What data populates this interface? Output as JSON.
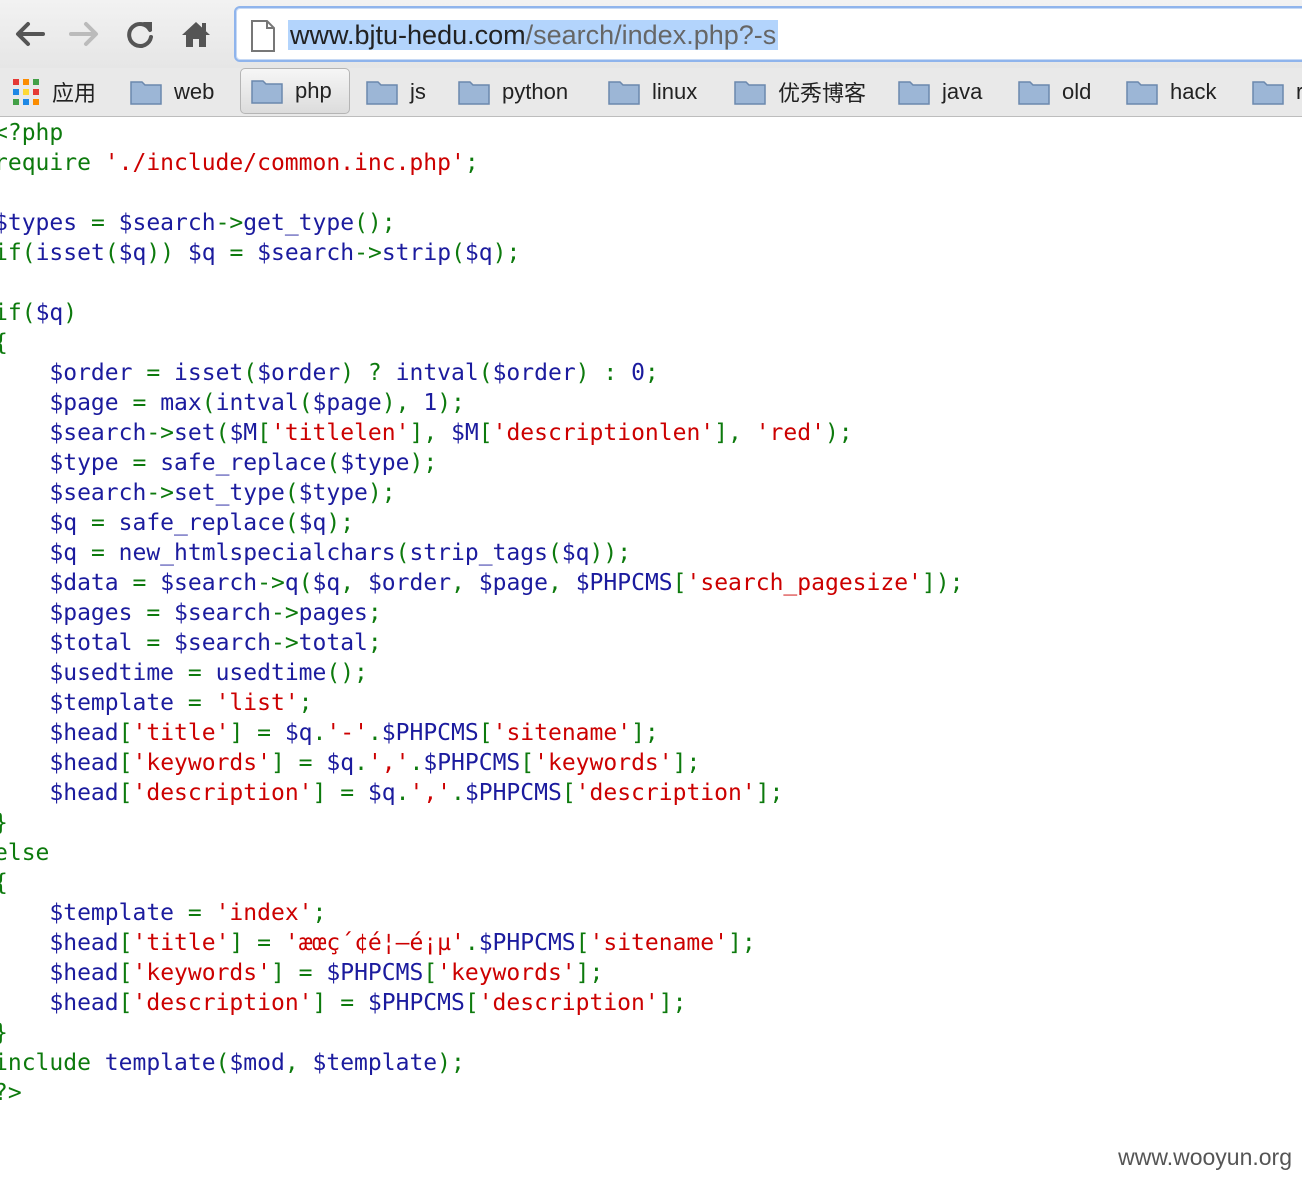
{
  "browser": {
    "url_host": "www.bjtu-hedu.com",
    "url_path": "/search/index.php?-s",
    "bookmarks": [
      {
        "label": "应用",
        "icon": "apps-grid-icon"
      },
      {
        "label": "web",
        "icon": "folder-icon"
      },
      {
        "label": "php",
        "icon": "folder-icon",
        "active": true
      },
      {
        "label": "js",
        "icon": "folder-icon"
      },
      {
        "label": "python",
        "icon": "folder-icon"
      },
      {
        "label": "linux",
        "icon": "folder-icon"
      },
      {
        "label": "优秀博客",
        "icon": "folder-icon"
      },
      {
        "label": "java",
        "icon": "folder-icon"
      },
      {
        "label": "old",
        "icon": "folder-icon"
      },
      {
        "label": "hack",
        "icon": "folder-icon"
      },
      {
        "label": "r",
        "icon": "folder-icon"
      }
    ]
  },
  "source": {
    "lines": [
      [
        [
          "kw",
          "<?php"
        ]
      ],
      [
        [
          "kw",
          "require "
        ],
        [
          "str",
          "'./include/common.inc.php'"
        ],
        [
          "op",
          ";"
        ]
      ],
      [],
      [
        [
          "var",
          "$types "
        ],
        [
          "op",
          "= "
        ],
        [
          "var",
          "$search"
        ],
        [
          "op",
          "->"
        ],
        [
          "fn",
          "get_type"
        ],
        [
          "op",
          "();"
        ]
      ],
      [
        [
          "kw",
          "if"
        ],
        [
          "op",
          "("
        ],
        [
          "fn",
          "isset"
        ],
        [
          "op",
          "("
        ],
        [
          "var",
          "$q"
        ],
        [
          "op",
          ")) "
        ],
        [
          "var",
          "$q "
        ],
        [
          "op",
          "= "
        ],
        [
          "var",
          "$search"
        ],
        [
          "op",
          "->"
        ],
        [
          "fn",
          "strip"
        ],
        [
          "op",
          "("
        ],
        [
          "var",
          "$q"
        ],
        [
          "op",
          ");"
        ]
      ],
      [],
      [
        [
          "kw",
          "if"
        ],
        [
          "op",
          "("
        ],
        [
          "var",
          "$q"
        ],
        [
          "op",
          ")"
        ]
      ],
      [
        [
          "op",
          "{"
        ]
      ],
      [
        [
          "op",
          "    "
        ],
        [
          "var",
          "$order "
        ],
        [
          "op",
          "= "
        ],
        [
          "fn",
          "isset"
        ],
        [
          "op",
          "("
        ],
        [
          "var",
          "$order"
        ],
        [
          "op",
          ") ? "
        ],
        [
          "fn",
          "intval"
        ],
        [
          "op",
          "("
        ],
        [
          "var",
          "$order"
        ],
        [
          "op",
          ") : "
        ],
        [
          "var",
          "0"
        ],
        [
          "op",
          ";"
        ]
      ],
      [
        [
          "op",
          "    "
        ],
        [
          "var",
          "$page "
        ],
        [
          "op",
          "= "
        ],
        [
          "fn",
          "max"
        ],
        [
          "op",
          "("
        ],
        [
          "fn",
          "intval"
        ],
        [
          "op",
          "("
        ],
        [
          "var",
          "$page"
        ],
        [
          "op",
          "), "
        ],
        [
          "var",
          "1"
        ],
        [
          "op",
          ");"
        ]
      ],
      [
        [
          "op",
          "    "
        ],
        [
          "var",
          "$search"
        ],
        [
          "op",
          "->"
        ],
        [
          "fn",
          "set"
        ],
        [
          "op",
          "("
        ],
        [
          "var",
          "$M"
        ],
        [
          "op",
          "["
        ],
        [
          "str",
          "'titlelen'"
        ],
        [
          "op",
          "], "
        ],
        [
          "var",
          "$M"
        ],
        [
          "op",
          "["
        ],
        [
          "str",
          "'descriptionlen'"
        ],
        [
          "op",
          "], "
        ],
        [
          "str",
          "'red'"
        ],
        [
          "op",
          ");"
        ]
      ],
      [
        [
          "op",
          "    "
        ],
        [
          "var",
          "$type "
        ],
        [
          "op",
          "= "
        ],
        [
          "fn",
          "safe_replace"
        ],
        [
          "op",
          "("
        ],
        [
          "var",
          "$type"
        ],
        [
          "op",
          ");"
        ]
      ],
      [
        [
          "op",
          "    "
        ],
        [
          "var",
          "$search"
        ],
        [
          "op",
          "->"
        ],
        [
          "fn",
          "set_type"
        ],
        [
          "op",
          "("
        ],
        [
          "var",
          "$type"
        ],
        [
          "op",
          ");"
        ]
      ],
      [
        [
          "op",
          "    "
        ],
        [
          "var",
          "$q "
        ],
        [
          "op",
          "= "
        ],
        [
          "fn",
          "safe_replace"
        ],
        [
          "op",
          "("
        ],
        [
          "var",
          "$q"
        ],
        [
          "op",
          ");"
        ]
      ],
      [
        [
          "op",
          "    "
        ],
        [
          "var",
          "$q "
        ],
        [
          "op",
          "= "
        ],
        [
          "fn",
          "new_htmlspecialchars"
        ],
        [
          "op",
          "("
        ],
        [
          "fn",
          "strip_tags"
        ],
        [
          "op",
          "("
        ],
        [
          "var",
          "$q"
        ],
        [
          "op",
          "));"
        ]
      ],
      [
        [
          "op",
          "    "
        ],
        [
          "var",
          "$data "
        ],
        [
          "op",
          "= "
        ],
        [
          "var",
          "$search"
        ],
        [
          "op",
          "->"
        ],
        [
          "fn",
          "q"
        ],
        [
          "op",
          "("
        ],
        [
          "var",
          "$q"
        ],
        [
          "op",
          ", "
        ],
        [
          "var",
          "$order"
        ],
        [
          "op",
          ", "
        ],
        [
          "var",
          "$page"
        ],
        [
          "op",
          ", "
        ],
        [
          "var",
          "$PHPCMS"
        ],
        [
          "op",
          "["
        ],
        [
          "str",
          "'search_pagesize'"
        ],
        [
          "op",
          "]);"
        ]
      ],
      [
        [
          "op",
          "    "
        ],
        [
          "var",
          "$pages "
        ],
        [
          "op",
          "= "
        ],
        [
          "var",
          "$search"
        ],
        [
          "op",
          "->"
        ],
        [
          "var",
          "pages"
        ],
        [
          "op",
          ";"
        ]
      ],
      [
        [
          "op",
          "    "
        ],
        [
          "var",
          "$total "
        ],
        [
          "op",
          "= "
        ],
        [
          "var",
          "$search"
        ],
        [
          "op",
          "->"
        ],
        [
          "var",
          "total"
        ],
        [
          "op",
          ";"
        ]
      ],
      [
        [
          "op",
          "    "
        ],
        [
          "var",
          "$usedtime "
        ],
        [
          "op",
          "= "
        ],
        [
          "fn",
          "usedtime"
        ],
        [
          "op",
          "();"
        ]
      ],
      [
        [
          "op",
          "    "
        ],
        [
          "var",
          "$template "
        ],
        [
          "op",
          "= "
        ],
        [
          "str",
          "'list'"
        ],
        [
          "op",
          ";"
        ]
      ],
      [
        [
          "op",
          "    "
        ],
        [
          "var",
          "$head"
        ],
        [
          "op",
          "["
        ],
        [
          "str",
          "'title'"
        ],
        [
          "op",
          "] = "
        ],
        [
          "var",
          "$q"
        ],
        [
          "op",
          "."
        ],
        [
          "str",
          "'-'"
        ],
        [
          "op",
          "."
        ],
        [
          "var",
          "$PHPCMS"
        ],
        [
          "op",
          "["
        ],
        [
          "str",
          "'sitename'"
        ],
        [
          "op",
          "];"
        ]
      ],
      [
        [
          "op",
          "    "
        ],
        [
          "var",
          "$head"
        ],
        [
          "op",
          "["
        ],
        [
          "str",
          "'keywords'"
        ],
        [
          "op",
          "] = "
        ],
        [
          "var",
          "$q"
        ],
        [
          "op",
          "."
        ],
        [
          "str",
          "','"
        ],
        [
          "op",
          "."
        ],
        [
          "var",
          "$PHPCMS"
        ],
        [
          "op",
          "["
        ],
        [
          "str",
          "'keywords'"
        ],
        [
          "op",
          "];"
        ]
      ],
      [
        [
          "op",
          "    "
        ],
        [
          "var",
          "$head"
        ],
        [
          "op",
          "["
        ],
        [
          "str",
          "'description'"
        ],
        [
          "op",
          "] = "
        ],
        [
          "var",
          "$q"
        ],
        [
          "op",
          "."
        ],
        [
          "str",
          "','"
        ],
        [
          "op",
          "."
        ],
        [
          "var",
          "$PHPCMS"
        ],
        [
          "op",
          "["
        ],
        [
          "str",
          "'description'"
        ],
        [
          "op",
          "];"
        ]
      ],
      [
        [
          "op",
          "}"
        ]
      ],
      [
        [
          "kw",
          "else"
        ]
      ],
      [
        [
          "op",
          "{"
        ]
      ],
      [
        [
          "op",
          "    "
        ],
        [
          "var",
          "$template "
        ],
        [
          "op",
          "= "
        ],
        [
          "str",
          "'index'"
        ],
        [
          "op",
          ";"
        ]
      ],
      [
        [
          "op",
          "    "
        ],
        [
          "var",
          "$head"
        ],
        [
          "op",
          "["
        ],
        [
          "str",
          "'title'"
        ],
        [
          "op",
          "] = "
        ],
        [
          "str",
          "'æœç´¢é¦–é¡µ'"
        ],
        [
          "op",
          "."
        ],
        [
          "var",
          "$PHPCMS"
        ],
        [
          "op",
          "["
        ],
        [
          "str",
          "'sitename'"
        ],
        [
          "op",
          "];"
        ]
      ],
      [
        [
          "op",
          "    "
        ],
        [
          "var",
          "$head"
        ],
        [
          "op",
          "["
        ],
        [
          "str",
          "'keywords'"
        ],
        [
          "op",
          "] = "
        ],
        [
          "var",
          "$PHPCMS"
        ],
        [
          "op",
          "["
        ],
        [
          "str",
          "'keywords'"
        ],
        [
          "op",
          "];"
        ]
      ],
      [
        [
          "op",
          "    "
        ],
        [
          "var",
          "$head"
        ],
        [
          "op",
          "["
        ],
        [
          "str",
          "'description'"
        ],
        [
          "op",
          "] = "
        ],
        [
          "var",
          "$PHPCMS"
        ],
        [
          "op",
          "["
        ],
        [
          "str",
          "'description'"
        ],
        [
          "op",
          "];"
        ]
      ],
      [
        [
          "op",
          "}"
        ]
      ],
      [
        [
          "kw",
          "include "
        ],
        [
          "fn",
          "template"
        ],
        [
          "op",
          "("
        ],
        [
          "var",
          "$mod"
        ],
        [
          "op",
          ", "
        ],
        [
          "var",
          "$template"
        ],
        [
          "op",
          ");"
        ]
      ],
      [
        [
          "kw",
          "?>"
        ]
      ]
    ]
  },
  "watermark": "www.wooyun.org"
}
